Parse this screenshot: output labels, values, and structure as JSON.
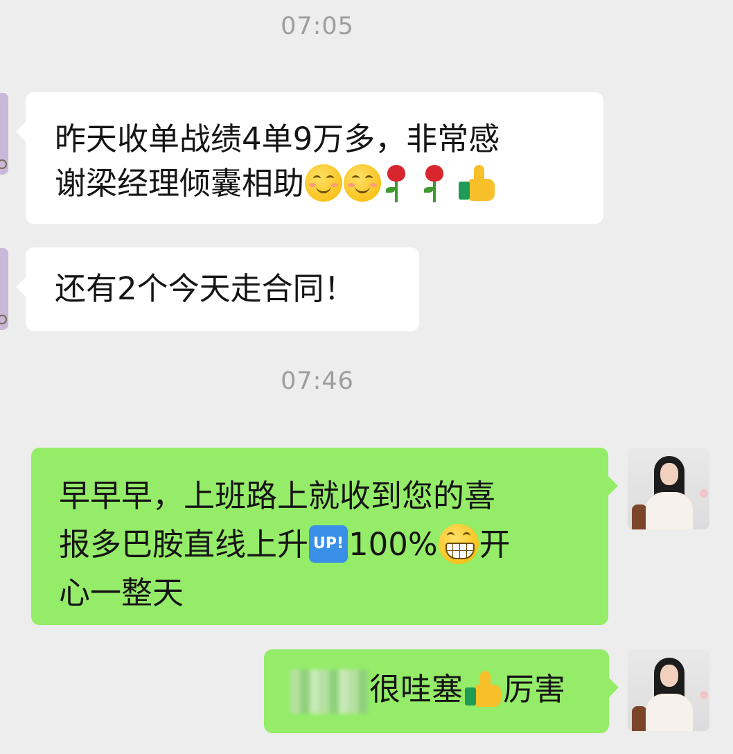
{
  "timestamps": [
    "07:05",
    "07:46"
  ],
  "messages": [
    {
      "direction": "incoming",
      "lines": [
        "昨天收单战绩4单9万多，非常感",
        "谢梁经理倾囊相助"
      ],
      "emojis": [
        "smiling-face-icon",
        "smiling-face-icon",
        "rose-icon",
        "rose-icon",
        "thumbs-up-icon"
      ]
    },
    {
      "direction": "incoming",
      "lines": [
        "还有2个今天走合同！"
      ]
    },
    {
      "direction": "outgoing",
      "line1": "早早早，上班路上就收到您的喜",
      "line2_a": "报多巴胺直线上升",
      "line2_b": "100%",
      "line2_c": "开",
      "line3": "心一整天",
      "emojis": [
        "up-button-icon",
        "grinning-face-icon"
      ]
    },
    {
      "direction": "outgoing",
      "text_a": "很哇塞",
      "text_b": "厉害",
      "emojis": [
        "thumbs-up-icon"
      ],
      "redacted": true
    }
  ],
  "up_badge_label": "UP!",
  "colors": {
    "background": "#ededed",
    "incoming_bubble": "#ffffff",
    "outgoing_bubble": "#95ec69",
    "timestamp": "#9d9d9d",
    "text": "#151515"
  }
}
